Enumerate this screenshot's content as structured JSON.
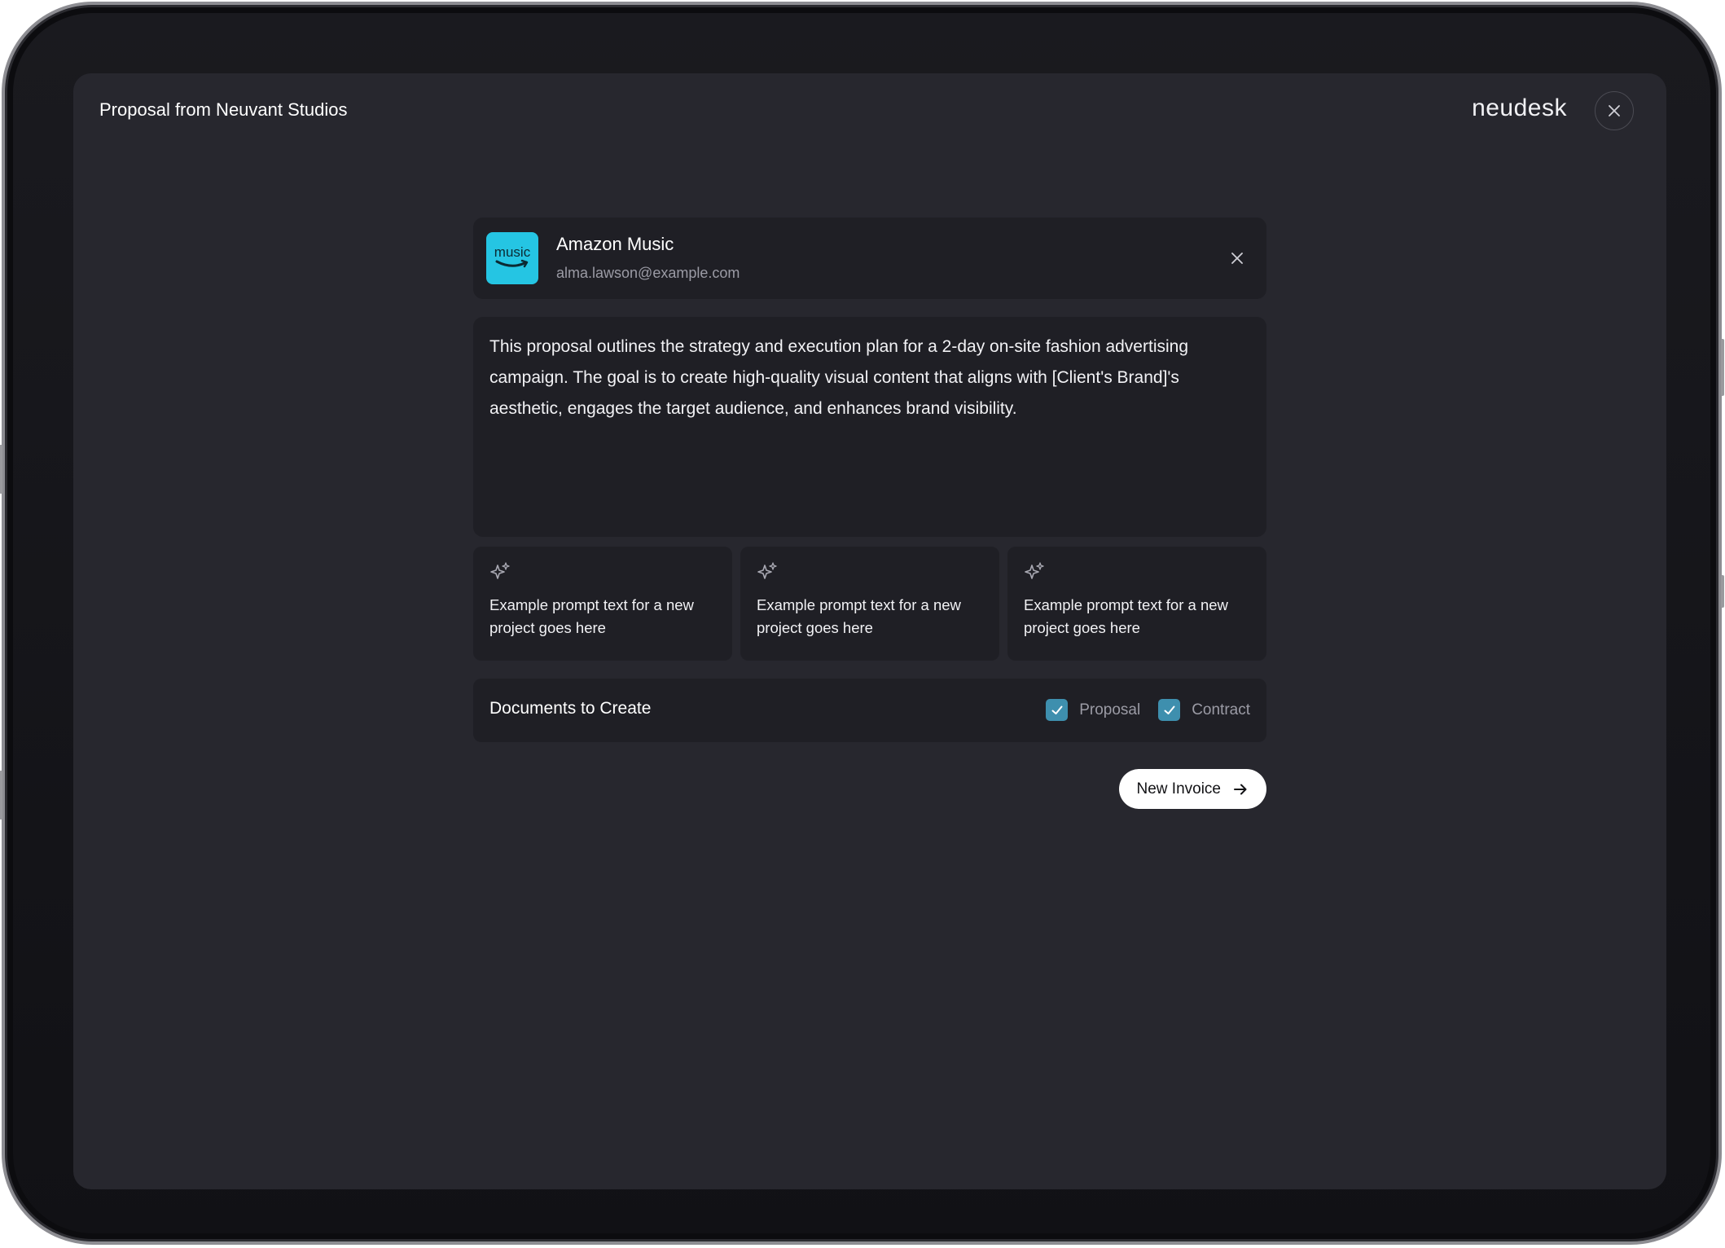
{
  "window": {
    "title": "Proposal from Neuvant Studios",
    "brand": "neudesk"
  },
  "client": {
    "logo_text": "music",
    "name": "Amazon Music",
    "email": "alma.lawson@example.com",
    "logo_color": "#25c5e3"
  },
  "description": "This proposal outlines the strategy and execution plan for a 2-day on-site fashion advertising campaign. The goal is to create high-quality visual content that aligns with [Client's Brand]'s aesthetic, engages the target audience, and enhances brand visibility.",
  "prompts": [
    {
      "text": "Example prompt text for a new project goes here",
      "icon": "sparkle-icon"
    },
    {
      "text": "Example prompt text for a new project goes here",
      "icon": "sparkle-icon"
    },
    {
      "text": "Example prompt text for a new project goes here",
      "icon": "sparkle-icon"
    }
  ],
  "documents": {
    "title": "Documents to Create",
    "options": [
      {
        "label": "Proposal",
        "checked": true
      },
      {
        "label": "Contract",
        "checked": true
      }
    ]
  },
  "actions": {
    "primary_label": "New Invoice"
  },
  "colors": {
    "screen_bg": "#27272e",
    "card_bg": "#1f1f25",
    "checkbox": "#3e8fae",
    "muted_text": "#9b9ba5"
  }
}
